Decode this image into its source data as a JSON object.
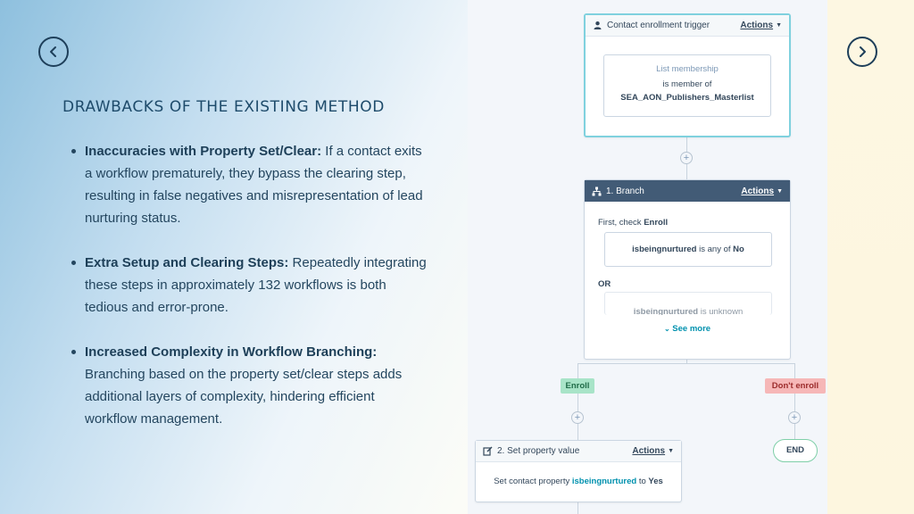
{
  "slide": {
    "title": "DRAWBACKS OF THE EXISTING METHOD",
    "bullets": [
      {
        "heading": "Inaccuracies with Property Set/Clear:",
        "text": " If a contact exits a workflow prematurely, they bypass the clearing step, resulting in false negatives and misrepresentation of lead nurturing status."
      },
      {
        "heading": "Extra Setup and Clearing Steps:",
        "text": " Repeatedly integrating these steps in approximately 132 workflows is both tedious and error-prone."
      },
      {
        "heading": "Increased Complexity in Workflow Branching:",
        "text": " Branching based on the property set/clear steps adds additional layers of complexity, hindering efficient workflow management."
      }
    ]
  },
  "navigation": {
    "prev_icon": "chevron-left-icon",
    "next_icon": "chevron-right-icon"
  },
  "workflow": {
    "trigger": {
      "title": "Contact enrollment trigger",
      "actions": "Actions",
      "label": "List membership",
      "condition": "is member of",
      "list_name": "SEA_AON_Publishers_Masterlist"
    },
    "branch": {
      "title": "1. Branch",
      "actions": "Actions",
      "first_check_prefix": "First, check ",
      "first_check_name": "Enroll",
      "condition1_prop": "isbeingnurtured",
      "condition1_op": " is any of ",
      "condition1_val": "No",
      "or_label": "OR",
      "condition2_prop": "isbeingnurtured",
      "condition2_op": " is unknown",
      "see_more": "See more"
    },
    "branch_labels": {
      "enroll": "Enroll",
      "dont_enroll": "Don't enroll"
    },
    "set_property": {
      "title": "2. Set property value",
      "actions": "Actions",
      "text_prefix": "Set contact property ",
      "property": "isbeingnurtured",
      "text_mid": " to ",
      "value": "Yes"
    },
    "end_label": "END",
    "colors": {
      "header_dark": "#425b76",
      "selected_border": "#7fd1de",
      "enroll_green": "#a8e4c8",
      "dont_enroll_red": "#f6b7b7",
      "link_teal": "#0091ae"
    }
  }
}
